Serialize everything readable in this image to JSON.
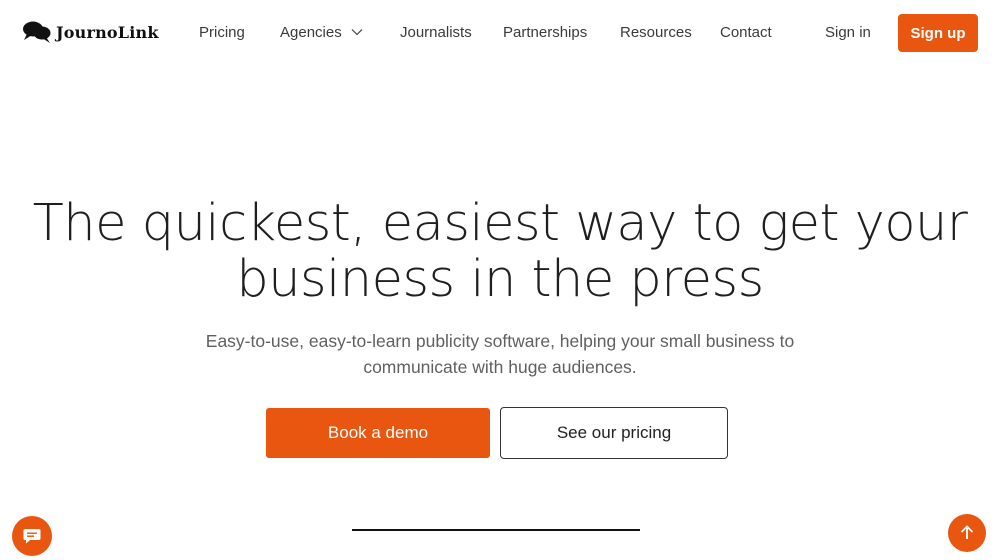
{
  "brand": {
    "name": "JournoLink",
    "logo_icon": "speech-bubbles-icon"
  },
  "nav": {
    "items": [
      {
        "label": "Pricing"
      },
      {
        "label": "Agencies",
        "icon": "chevron-down-icon"
      },
      {
        "label": "Journalists"
      },
      {
        "label": "Partnerships"
      },
      {
        "label": "Resources"
      },
      {
        "label": "Contact"
      }
    ],
    "sign_in": "Sign in",
    "sign_up": "Sign up"
  },
  "hero": {
    "title_line1": "The quickest, easiest way to get your",
    "title_line2": "business in the press",
    "subtitle_line1": "Easy-to-use, easy-to-learn publicity software, helping your small business to",
    "subtitle_line2": "communicate with huge audiences.",
    "primary_cta": "Book a demo",
    "secondary_cta": "See our pricing"
  },
  "floating": {
    "chat_icon": "chat-icon",
    "scroll_top_icon": "arrow-up-icon"
  },
  "colors": {
    "accent": "#e8560f",
    "text_dark": "#1f1f1f",
    "text_muted": "#606060",
    "background": "#ffffff"
  }
}
